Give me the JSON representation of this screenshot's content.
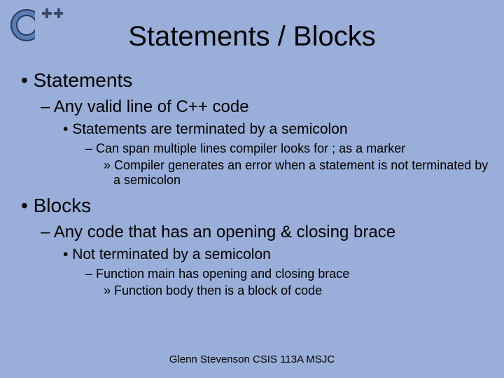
{
  "title": "Statements / Blocks",
  "items": {
    "a": "Statements",
    "a1": "Any valid line of C++ code",
    "a1a": "Statements are terminated by a semicolon",
    "a1a1": "Can span multiple lines compiler looks for ; as a marker",
    "a1a1a": "Compiler generates an error when a statement is not terminated by a semicolon",
    "b": "Blocks",
    "b1": "Any code that has an opening & closing brace",
    "b1a": "Not terminated by a semicolon",
    "b1a1": "Function main has opening and closing brace",
    "b1a1a": "Function body then is a block of code"
  },
  "footer": "Glenn Stevenson CSIS 113A MSJC"
}
